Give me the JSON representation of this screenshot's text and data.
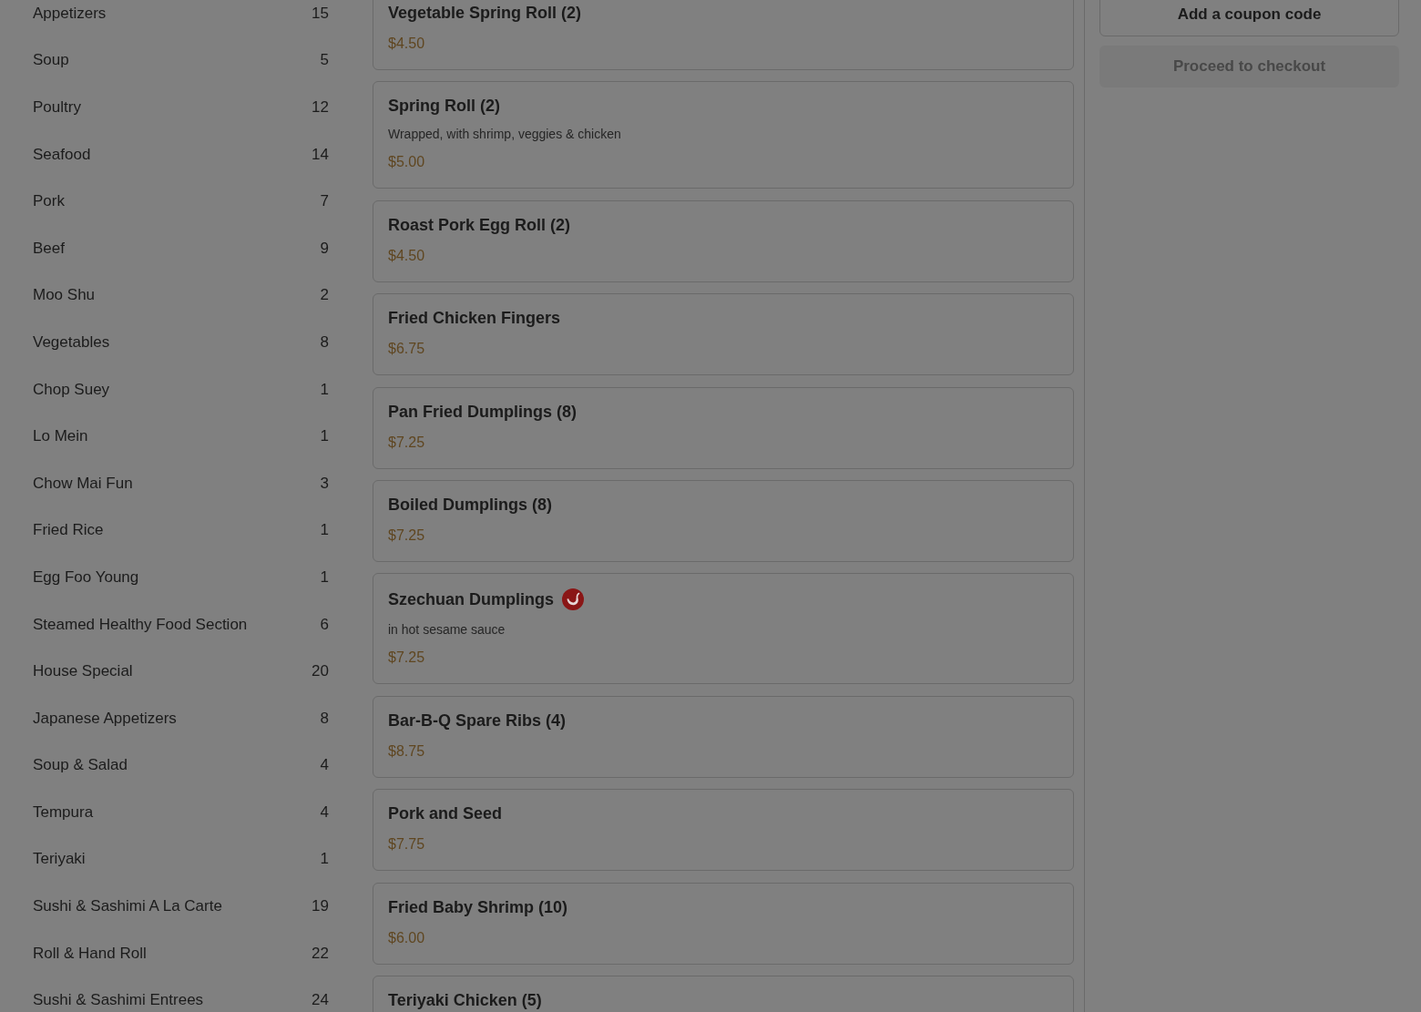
{
  "categories": [
    {
      "name": "Appetizers",
      "count": "15"
    },
    {
      "name": "Soup",
      "count": "5"
    },
    {
      "name": "Poultry",
      "count": "12"
    },
    {
      "name": "Seafood",
      "count": "14"
    },
    {
      "name": "Pork",
      "count": "7"
    },
    {
      "name": "Beef",
      "count": "9"
    },
    {
      "name": "Moo Shu",
      "count": "2"
    },
    {
      "name": "Vegetables",
      "count": "8"
    },
    {
      "name": "Chop Suey",
      "count": "1"
    },
    {
      "name": "Lo Mein",
      "count": "1"
    },
    {
      "name": "Chow Mai Fun",
      "count": "3"
    },
    {
      "name": "Fried Rice",
      "count": "1"
    },
    {
      "name": "Egg Foo Young",
      "count": "1"
    },
    {
      "name": "Steamed Healthy Food Section",
      "count": "6"
    },
    {
      "name": "House Special",
      "count": "20"
    },
    {
      "name": "Japanese Appetizers",
      "count": "8"
    },
    {
      "name": "Soup & Salad",
      "count": "4"
    },
    {
      "name": "Tempura",
      "count": "4"
    },
    {
      "name": "Teriyaki",
      "count": "1"
    },
    {
      "name": "Sushi & Sashimi A La Carte",
      "count": "19"
    },
    {
      "name": "Roll & Hand Roll",
      "count": "22"
    },
    {
      "name": "Sushi & Sashimi Entrees",
      "count": "24"
    }
  ],
  "menu_items": [
    {
      "name": "Vegetable Spring Roll (2)",
      "spicy": false,
      "price": "$4.50"
    },
    {
      "name": "Spring Roll (2)",
      "spicy": false,
      "description": "Wrapped, with shrimp, veggies & chicken",
      "price": "$5.00"
    },
    {
      "name": "Roast Pork Egg Roll (2)",
      "spicy": false,
      "price": "$4.50"
    },
    {
      "name": "Fried Chicken Fingers",
      "spicy": false,
      "price": "$6.75"
    },
    {
      "name": "Pan Fried Dumplings (8)",
      "spicy": false,
      "price": "$7.25"
    },
    {
      "name": "Boiled Dumplings (8)",
      "spicy": false,
      "price": "$7.25"
    },
    {
      "name": "Szechuan Dumplings",
      "spicy": true,
      "description": "in hot sesame sauce",
      "price": "$7.25"
    },
    {
      "name": "Bar-B-Q Spare Ribs (4)",
      "spicy": false,
      "price": "$8.75"
    },
    {
      "name": "Pork and Seed",
      "spicy": false,
      "price": "$7.75"
    },
    {
      "name": "Fried Baby Shrimp (10)",
      "spicy": false,
      "price": "$6.00"
    },
    {
      "name": "Teriyaki Chicken (5)",
      "spicy": false
    }
  ],
  "cart": {
    "coupon_button": {
      "label": "Add a coupon code"
    },
    "checkout_button": {
      "label": "Proceed to checkout",
      "disabled": true
    }
  }
}
